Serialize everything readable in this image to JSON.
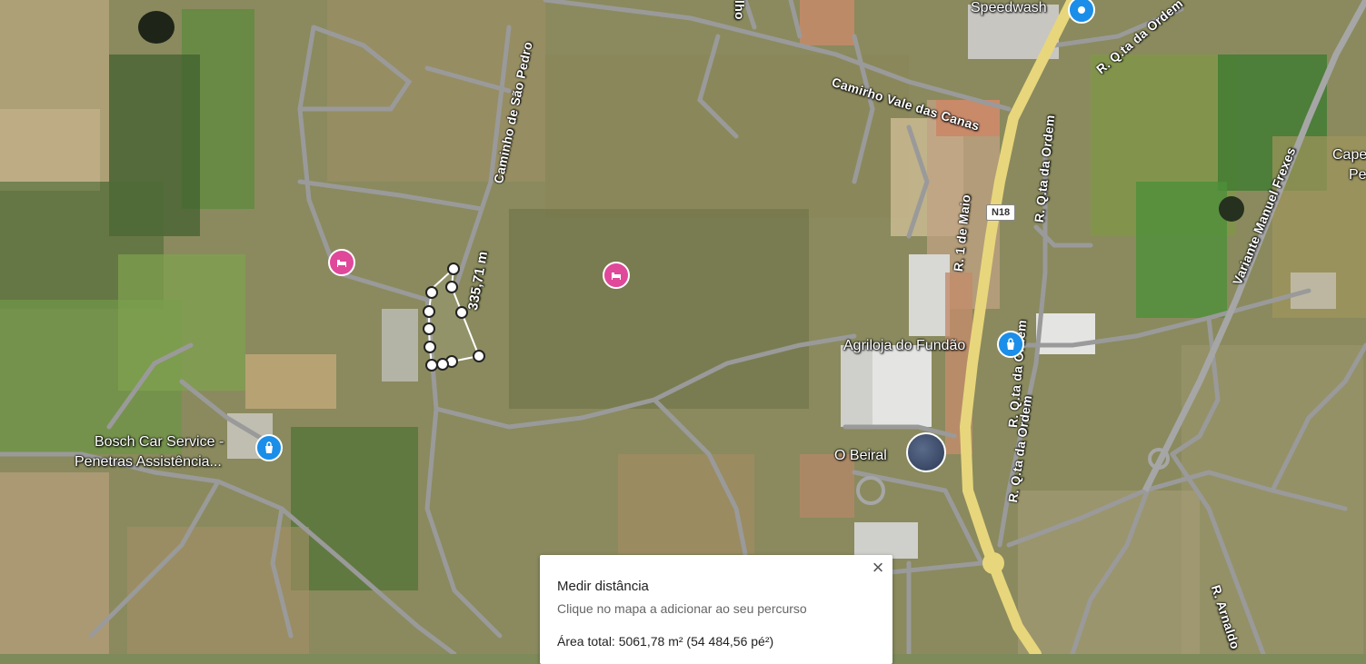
{
  "map": {
    "roads": {
      "camino_vale_canas": "Camirho Vale das Canas",
      "caminho_sao_pedro": "Caminho de São Pedro",
      "rua_1_maio": "R. 1 de Maio",
      "rua_qta_ordem_top": "R. Q.ta da Ordem",
      "rua_qta_ordem_mid": "R. Q.ta da Ordem",
      "rua_qta_ordem_low": "R. Q.ta da Ordem",
      "rua_qta_ordem_bottom": "R. Q.ta da Ordem",
      "variante": "Variante Manuel Frexes",
      "rua_arnaldo": "R. Arnaldo",
      "top_fragment": "lho",
      "n18": "N18"
    },
    "pois": {
      "speedwash": "Speedwash",
      "agriloja": "Agriloja do Fundão",
      "bosch_line1": "Bosch Car Service -",
      "bosch_line2": "Penetras Assistência...",
      "o_beiral": "O Beiral",
      "cape_fragment1": "Cape",
      "cape_fragment2": "Pe"
    },
    "measurement_label": "335,71 m",
    "icons": {
      "shopping": "shopping-bag-icon",
      "hotel": "hotel-bed-icon",
      "pin": "map-pin-icon"
    },
    "colors": {
      "main_road": "#e8d67c",
      "minor_road": "#9a9a9a",
      "poi_blue": "#1a8ee8",
      "poi_pink": "#e0489a"
    }
  },
  "panel": {
    "title": "Medir distância",
    "subtitle": "Clique no mapa a adicionar ao seu percurso",
    "area_total": "Área total: 5061,78 m² (54 484,56 pé²)",
    "close_label": "×"
  }
}
